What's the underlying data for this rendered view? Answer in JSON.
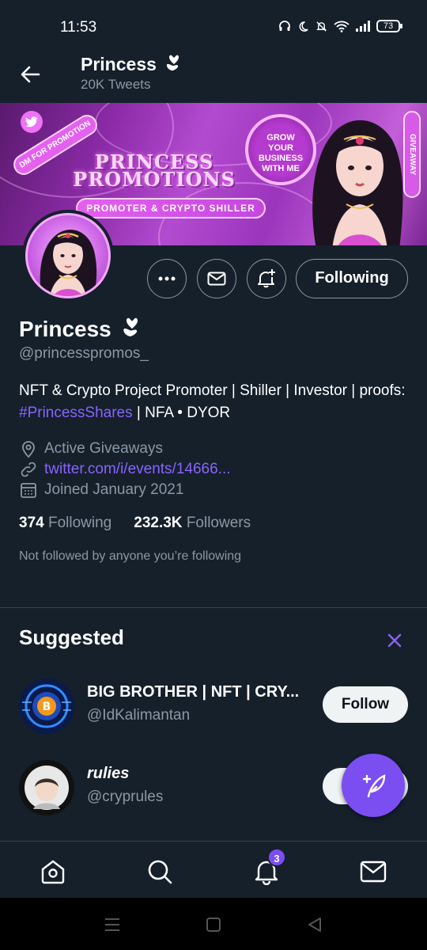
{
  "status_bar": {
    "time": "11:53",
    "battery": "73"
  },
  "header": {
    "name": "Princess",
    "tweet_count": "20K Tweets"
  },
  "banner": {
    "title_line1": "PRINCESS",
    "title_line2": "PROMOTIONS",
    "ribbon": "PROMOTER & CRYPTO SHILLER",
    "dm_pill": "DM FOR PROMOTION",
    "badge_line1": "GROW",
    "badge_line2": "YOUR",
    "badge_line3": "BUSINESS",
    "badge_line4": "WITH ME",
    "side_tag": "GIVEAWAY"
  },
  "actions": {
    "following_label": "Following"
  },
  "profile": {
    "name": "Princess",
    "handle": "@princesspromos_",
    "bio_prefix": "NFT & Crypto Project Promoter | Shiller | Investor | proofs: ",
    "bio_hashtag": "#PrincessShares",
    "bio_suffix": " | NFA • DYOR",
    "location": "Active Giveaways",
    "link": "twitter.com/i/events/14666...",
    "joined": "Joined January 2021",
    "following_count": "374",
    "following_label": "Following",
    "followers_count": "232.3K",
    "followers_label": "Followers",
    "not_followed": "Not followed by anyone you’re following"
  },
  "suggested": {
    "title": "Suggested",
    "items": [
      {
        "name": "BIG BROTHER | NFT | CRY...",
        "handle": "@IdKalimantan",
        "button": "Follow"
      },
      {
        "name": "rulies",
        "handle": "@cryprules",
        "button": "Follow"
      }
    ]
  },
  "bottom_nav": {
    "notifications_badge": "3"
  },
  "colors": {
    "background": "#15202b",
    "accent": "#7b4ef2",
    "link": "#8a63ff",
    "muted": "#8b98a5"
  }
}
